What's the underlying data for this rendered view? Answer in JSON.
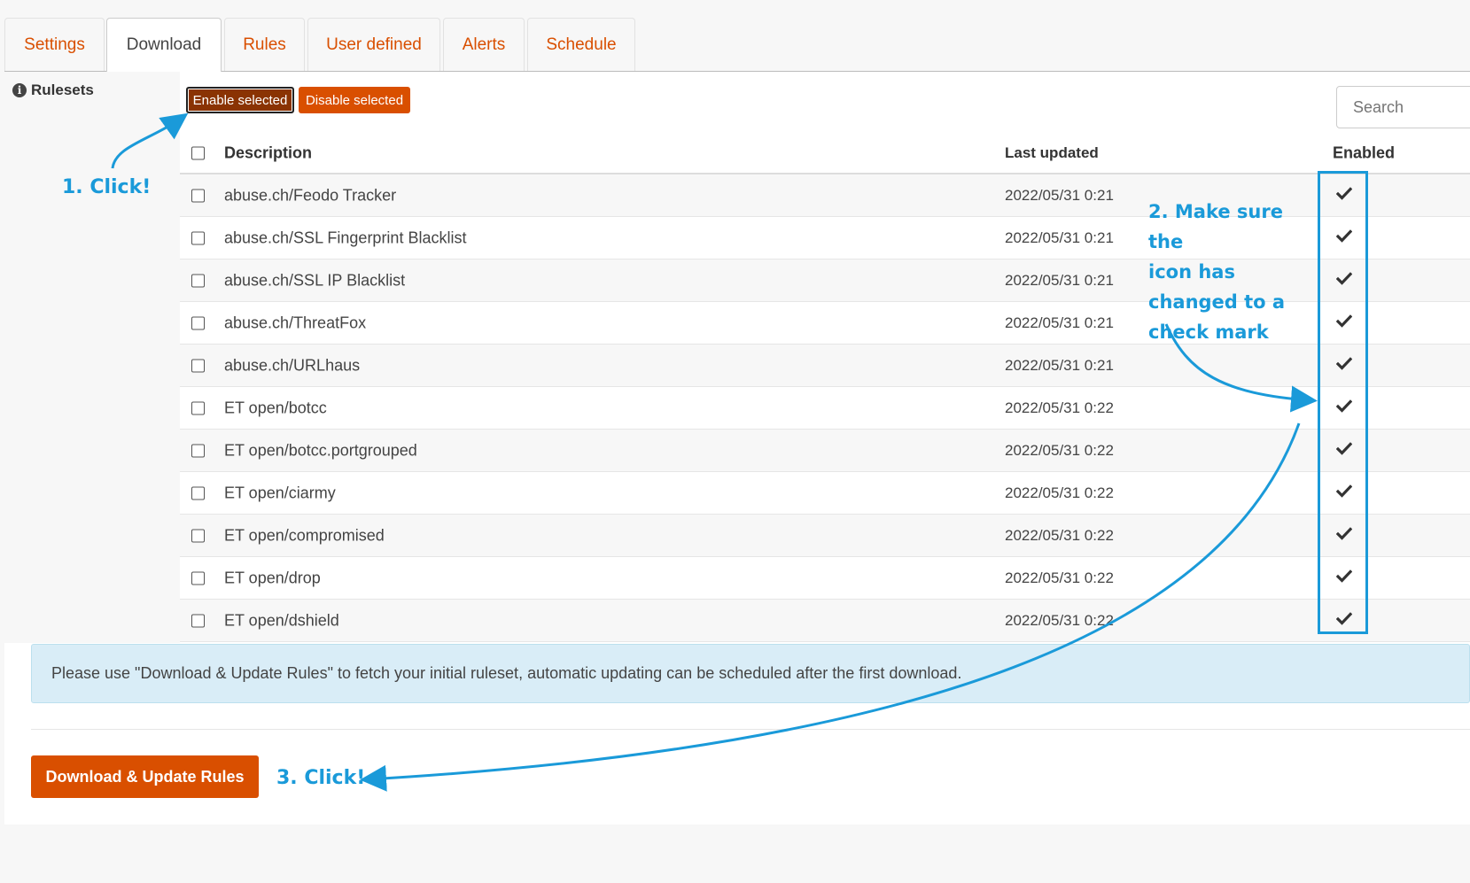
{
  "tabs": [
    {
      "label": "Settings",
      "active": false
    },
    {
      "label": "Download",
      "active": true
    },
    {
      "label": "Rules",
      "active": false
    },
    {
      "label": "User defined",
      "active": false
    },
    {
      "label": "Alerts",
      "active": false
    },
    {
      "label": "Schedule",
      "active": false
    }
  ],
  "section": {
    "label": "Rulesets",
    "icon": "info-icon"
  },
  "toolbar": {
    "enable_label": "Enable selected",
    "disable_label": "Disable selected",
    "search_placeholder": "Search"
  },
  "table": {
    "headers": {
      "description": "Description",
      "last_updated": "Last updated",
      "enabled": "Enabled"
    },
    "rows": [
      {
        "description": "abuse.ch/Feodo Tracker",
        "last_updated": "2022/05/31 0:21",
        "enabled": true
      },
      {
        "description": "abuse.ch/SSL Fingerprint Blacklist",
        "last_updated": "2022/05/31 0:21",
        "enabled": true
      },
      {
        "description": "abuse.ch/SSL IP Blacklist",
        "last_updated": "2022/05/31 0:21",
        "enabled": true
      },
      {
        "description": "abuse.ch/ThreatFox",
        "last_updated": "2022/05/31 0:21",
        "enabled": true
      },
      {
        "description": "abuse.ch/URLhaus",
        "last_updated": "2022/05/31 0:21",
        "enabled": true
      },
      {
        "description": "ET open/botcc",
        "last_updated": "2022/05/31 0:22",
        "enabled": true
      },
      {
        "description": "ET open/botcc.portgrouped",
        "last_updated": "2022/05/31 0:22",
        "enabled": true
      },
      {
        "description": "ET open/ciarmy",
        "last_updated": "2022/05/31 0:22",
        "enabled": true
      },
      {
        "description": "ET open/compromised",
        "last_updated": "2022/05/31 0:22",
        "enabled": true
      },
      {
        "description": "ET open/drop",
        "last_updated": "2022/05/31 0:22",
        "enabled": true
      },
      {
        "description": "ET open/dshield",
        "last_updated": "2022/05/31 0:22",
        "enabled": true
      }
    ]
  },
  "alert": {
    "text": "Please use \"Download & Update Rules\" to fetch your initial ruleset, automatic updating can be scheduled after the first download."
  },
  "download_button": {
    "label": "Download & Update Rules"
  },
  "annotations": {
    "step1": "1. Click!",
    "step2_lines": [
      "2. Make sure the",
      "icon has",
      "changed to a",
      "check mark"
    ],
    "step3": "3. Click!"
  },
  "colors": {
    "accent": "#d94f00",
    "accent_dark": "#8a3303",
    "annotation": "#1a9ad9",
    "alert_bg": "#d9edf7"
  }
}
